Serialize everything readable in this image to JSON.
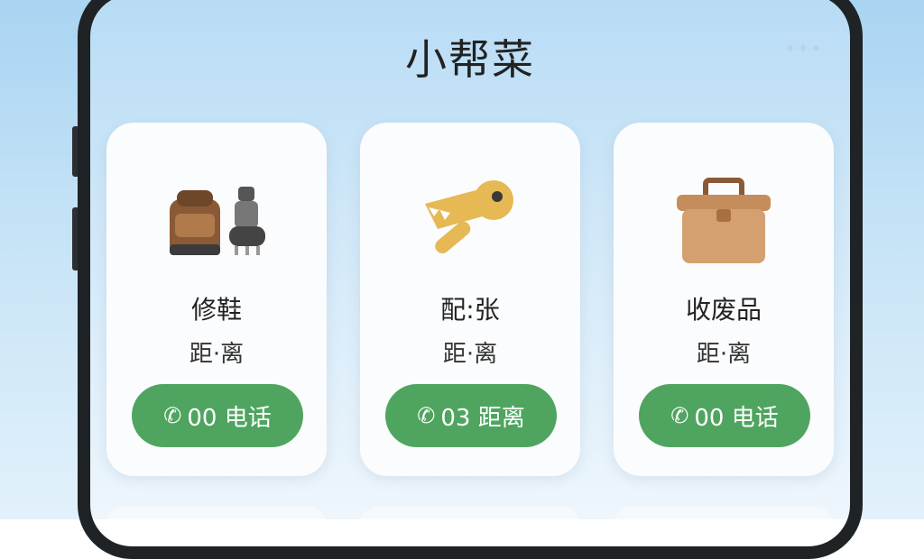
{
  "app": {
    "title": "小帮菜"
  },
  "cards": [
    {
      "name": "修鞋",
      "distance": "距·离",
      "button_label": "00 电话",
      "icon": "bag-and-shoe-icon"
    },
    {
      "name": "配:张",
      "distance": "距·离",
      "button_label": "03 距离",
      "icon": "key-icon"
    },
    {
      "name": "收废品",
      "distance": "距·离",
      "button_label": "00 电话",
      "icon": "box-icon"
    }
  ],
  "colors": {
    "accent_green": "#4fa55f",
    "card_bg": "#fbfcfd",
    "background_top": "#b8dcf5"
  }
}
